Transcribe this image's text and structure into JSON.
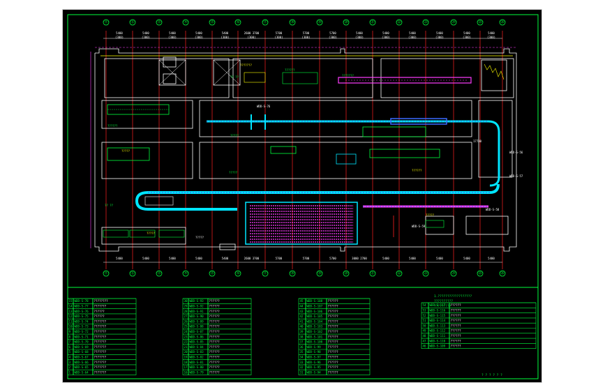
{
  "drawing": {
    "axes_top": [
      "⑪",
      "⑫",
      "⑬",
      "⑭",
      "⑮",
      "⑯",
      "⑰",
      "⑱",
      "⑲",
      "⑳",
      "㉑",
      "㉒",
      "㉓",
      "㉔",
      "㉕",
      "㉖"
    ],
    "axes_bottom": [
      "⑪",
      "⑫",
      "⑬",
      "⑭",
      "⑮",
      "⑯",
      "⑰",
      "⑱",
      "⑲",
      "⑳",
      "㉑",
      "㉒",
      "㉓",
      "㉔",
      "㉕",
      "㉖"
    ],
    "dims_top": [
      "5400",
      "5400",
      "5400",
      "5400",
      "5400",
      "2600 3700",
      "5700",
      "5700",
      "5700",
      "5400",
      "5400",
      "5400",
      "5400",
      "5400",
      "5400"
    ],
    "dims_top_sub": [
      "(300)",
      "(300)",
      "(300)",
      "(300)",
      "(300)",
      "(300)",
      "(300)",
      "(300)",
      "(300)",
      "(300)",
      "(300)",
      "(300)",
      "(300)",
      "(300)",
      "(300)"
    ],
    "dims_bottom": [
      "5400",
      "5400",
      "5400",
      "5400",
      "5400",
      "2600 3700",
      "5700",
      "5700",
      "5700",
      "3000 2700",
      "5400",
      "5400",
      "5400",
      "5400",
      "5400"
    ],
    "labels": {
      "l1": "???????",
      "l2": "?? ??",
      "l3": "???????",
      "l4": "??????",
      "l5": "WDD-S-76",
      "l6": "??????",
      "l7": "?????",
      "l8": "?????",
      "l9": "?????",
      "l10": "??????",
      "l11": "?????",
      "l12": "?? ??",
      "l13": "WDD-S-56",
      "l14": "WDD-S-57",
      "l15": "WDD-S-58",
      "l16": "WDD-S-59",
      "l17": "?????",
      "l18": "?????",
      "l19": "17700"
    }
  },
  "table1": {
    "rows": [
      [
        "15",
        "WDD-S-78",
        "????????"
      ],
      [
        "14",
        "WDD-S-77",
        "???????"
      ],
      [
        "13",
        "WDD-S-76",
        "??????"
      ],
      [
        "12",
        "WDD-S-75",
        "??????"
      ],
      [
        "11",
        "WDD-S-74",
        "???????"
      ],
      [
        "10",
        "WDD-S-73",
        "???????"
      ],
      [
        "9",
        "WDD-S-72",
        "???????"
      ],
      [
        "8",
        "WDD-S-71",
        "???????"
      ],
      [
        "7",
        "WDD-S-70",
        "???????"
      ],
      [
        "6",
        "WDD-S-69",
        "???????"
      ],
      [
        "5",
        "WDD-S-68",
        "???????"
      ],
      [
        "4",
        "WDD-S-67",
        "???????"
      ],
      [
        "3",
        "WDD-S-66",
        "???????"
      ],
      [
        "2",
        "WDD-S-65",
        "???????"
      ],
      [
        "1",
        "WDD-S-64",
        "???????"
      ]
    ]
  },
  "table2": {
    "rows": [
      [
        "30",
        "WDD-S-93",
        "??????"
      ],
      [
        "29",
        "WDD-S-92",
        "??????"
      ],
      [
        "28",
        "WDD-S-91",
        "??????"
      ],
      [
        "27",
        "WDD-S-90",
        "??????"
      ],
      [
        "26",
        "WDD-S-89",
        "??????"
      ],
      [
        "25",
        "WDD-S-88",
        "??????"
      ],
      [
        "24",
        "WDD-S-87",
        "??????"
      ],
      [
        "23",
        "WDD-S-86",
        "??????"
      ],
      [
        "22",
        "WDD-S-85",
        "??????"
      ],
      [
        "21",
        "WDD-S-84",
        "??????"
      ],
      [
        "20",
        "WDD-S-83",
        "??????"
      ],
      [
        "19",
        "WDD-S-82",
        "??????"
      ],
      [
        "18",
        "WDD-S-81",
        "??????"
      ],
      [
        "17",
        "WDD-S-80",
        "??????"
      ],
      [
        "16",
        "WDD-S-79",
        "??????"
      ]
    ]
  },
  "table3": {
    "rows": [
      [
        "45",
        "WDD-S-108",
        "??????"
      ],
      [
        "44",
        "WDD-S-107",
        "??????"
      ],
      [
        "43",
        "WDD-S-106",
        "??????"
      ],
      [
        "42",
        "WDD-S-105",
        "??????"
      ],
      [
        "41",
        "WDD-S-104",
        "??????"
      ],
      [
        "40",
        "WDD-S-103",
        "??????"
      ],
      [
        "39",
        "WDD-S-102",
        "??????"
      ],
      [
        "38",
        "WDD-S-101",
        "??????"
      ],
      [
        "37",
        "WDD-S-100",
        "??????"
      ],
      [
        "36",
        "WDD-S-99",
        "??????"
      ],
      [
        "35",
        "WDD-S-98",
        "??????"
      ],
      [
        "34",
        "WDD-S-97",
        "??????"
      ],
      [
        "33",
        "WDD-S-96",
        "??????"
      ],
      [
        "32",
        "WDD-S-95",
        "??????"
      ],
      [
        "31",
        "WDD-S-94",
        "??????"
      ]
    ]
  },
  "table4": {
    "rows": [
      [
        "54",
        "WDD-S-117",
        "??????"
      ],
      [
        "53",
        "WDD-S-116",
        "??????"
      ],
      [
        "52",
        "WDD-S-115",
        "??????"
      ],
      [
        "51",
        "WDD-S-114",
        "??????"
      ],
      [
        "50",
        "WDD-S-113",
        "??????"
      ],
      [
        "49",
        "WDD-S-112",
        "??????"
      ],
      [
        "48",
        "WDD-S-111",
        "??????"
      ],
      [
        "47",
        "WDD-S-110",
        "??????"
      ],
      [
        "46",
        "WDD-S-109",
        "??????"
      ]
    ]
  },
  "notes": {
    "title": "1.??????????????????",
    "line1": "??????????",
    "line2": "?????????",
    "footer": "? ? ? ? ? ?"
  }
}
